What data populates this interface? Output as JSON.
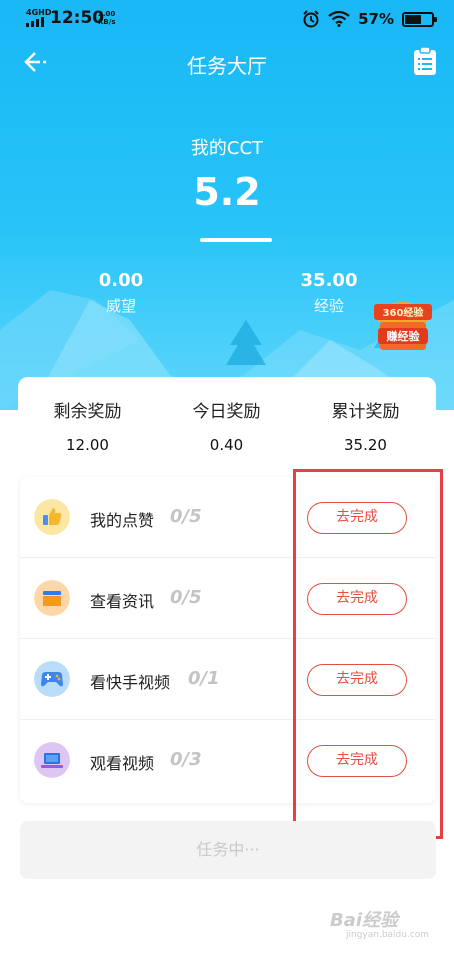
{
  "status_bar": {
    "network": "4GHD",
    "time": "12:50",
    "speed": "2.00",
    "speed_unit": "KB/s",
    "battery": "57%"
  },
  "nav": {
    "title": "任务大厅"
  },
  "cct": {
    "label": "我的CCT",
    "value": "5.2"
  },
  "stats": {
    "prestige": {
      "value": "0.00",
      "label": "威望"
    },
    "experience": {
      "value": "35.00",
      "label": "经验"
    }
  },
  "promo": {
    "top_text": "360经验",
    "bottom_text": "赚经验"
  },
  "rewards": [
    {
      "label": "剩余奖励",
      "value": "12.00"
    },
    {
      "label": "今日奖励",
      "value": "0.40"
    },
    {
      "label": "累计奖励",
      "value": "35.20"
    }
  ],
  "tasks": [
    {
      "name": "我的点赞",
      "progress": "0/5",
      "button": "去完成",
      "icon": "thumbs-up-icon"
    },
    {
      "name": "查看资讯",
      "progress": "0/5",
      "button": "去完成",
      "icon": "news-icon"
    },
    {
      "name": "看快手视频",
      "progress": "0/1",
      "button": "去完成",
      "icon": "gamepad-icon"
    },
    {
      "name": "观看视频",
      "progress": "0/3",
      "button": "去完成",
      "icon": "laptop-icon"
    }
  ],
  "action_button": "任务中···",
  "watermark": {
    "main": "Bai经验",
    "sub": "jingyan.baidu.com"
  },
  "colors": {
    "hero_top": "#19b8f6",
    "accent_red": "#e25040",
    "highlight": "#e64045"
  }
}
